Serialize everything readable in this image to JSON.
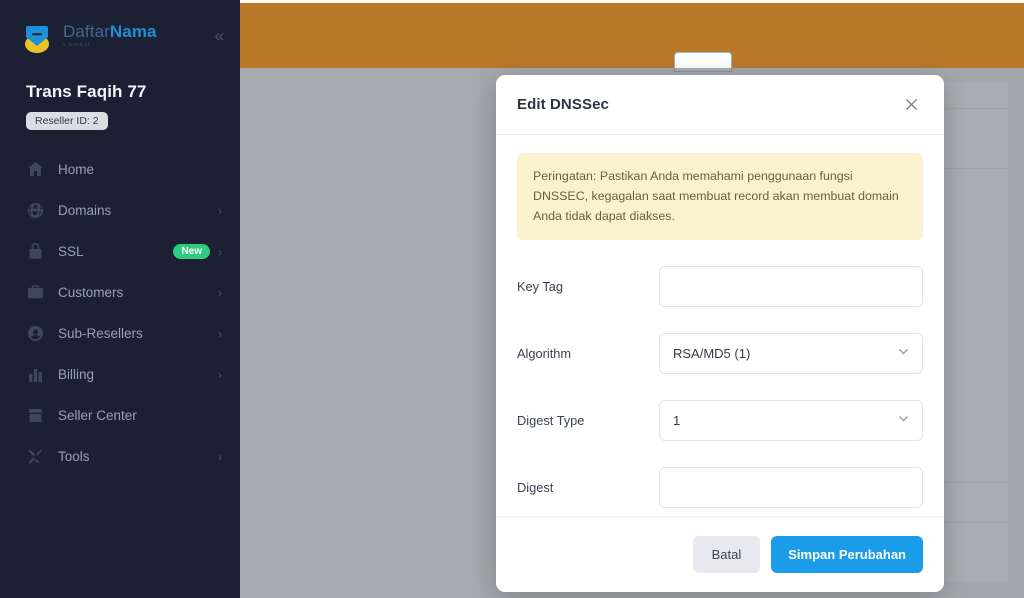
{
  "sidebar": {
    "logo": {
      "name_part1": "Daftar",
      "name_part2": "Nama",
      "subtitle": "a brand of",
      "icon": "daftarnama-logo-icon"
    },
    "collapse_icon": "chevron-double-left-icon",
    "account": {
      "name": "Trans Faqih 77",
      "badge": "Reseller ID: 2"
    },
    "items": [
      {
        "label": "Home",
        "icon": "home-icon",
        "badge": null,
        "arrow": false
      },
      {
        "label": "Domains",
        "icon": "globe-icon",
        "badge": null,
        "arrow": true
      },
      {
        "label": "SSL",
        "icon": "lock-icon",
        "badge": "New",
        "arrow": true
      },
      {
        "label": "Customers",
        "icon": "briefcase-icon",
        "badge": null,
        "arrow": true
      },
      {
        "label": "Sub-Resellers",
        "icon": "user-circle-icon",
        "badge": null,
        "arrow": true
      },
      {
        "label": "Billing",
        "icon": "chart-bars-icon",
        "badge": null,
        "arrow": true
      },
      {
        "label": "Seller Center",
        "icon": "store-icon",
        "badge": null,
        "arrow": false
      },
      {
        "label": "Tools",
        "icon": "tools-icon",
        "badge": null,
        "arrow": true
      }
    ],
    "arrow_glyph": "›",
    "collapse_glyph": "«"
  },
  "colors": {
    "sidebar_bg": "#1b2033",
    "topbar": "#b9792b",
    "badge_new": "#2ecc80",
    "primary": "#1a9ce8",
    "warning_bg": "#faf2cf",
    "warning_text": "#6a6039"
  },
  "modal": {
    "title": "Edit DNSSec",
    "close_icon": "close-icon",
    "warning": "Peringatan: Pastikan Anda memahami penggunaan fungsi DNSSEC, kegagalan saat membuat record akan membuat domain Anda tidak dapat diakses.",
    "fields": [
      {
        "label": "Key Tag",
        "type": "text",
        "value": "",
        "placeholder": ""
      },
      {
        "label": "Algorithm",
        "type": "select",
        "value": "RSA/MD5 (1)"
      },
      {
        "label": "Digest Type",
        "type": "select",
        "value": "1"
      },
      {
        "label": "Digest",
        "type": "text",
        "value": "",
        "placeholder": ""
      }
    ],
    "chevron_icon": "chevron-down-icon",
    "buttons": {
      "cancel": "Batal",
      "save": "Simpan Perubahan"
    }
  }
}
